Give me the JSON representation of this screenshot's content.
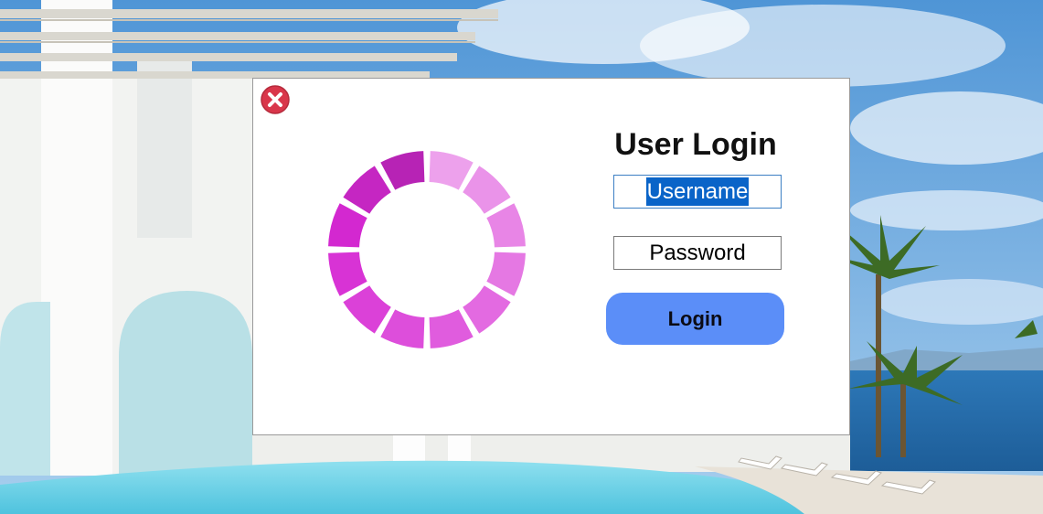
{
  "dialog": {
    "title": "User Login",
    "username": {
      "value": "Username",
      "selected": true
    },
    "password": {
      "value": "Password"
    },
    "login_label": "Login"
  },
  "icons": {
    "close": "close-icon",
    "loader": "loading-spinner-icon"
  },
  "colors": {
    "close_red": "#d9364a",
    "spinner_magenta": "#c21fb8",
    "login_button": "#5b8ef8",
    "selection": "#0a64c8"
  }
}
